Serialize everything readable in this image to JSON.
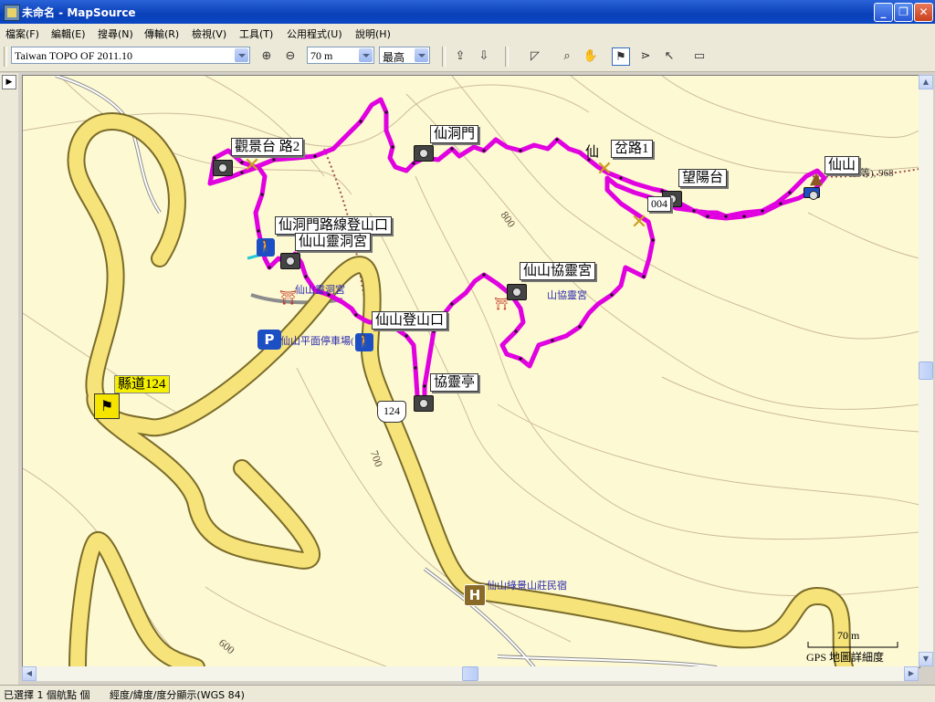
{
  "window": {
    "title": "未命名 - MapSource",
    "buttons": {
      "minimize": "_",
      "maximize": "❐",
      "close": "✕"
    }
  },
  "menu": [
    "檔案(F)",
    "編輯(E)",
    "搜尋(N)",
    "傳輸(R)",
    "檢視(V)",
    "工具(T)",
    "公用程式(U)",
    "說明(H)"
  ],
  "toolbar": {
    "map_product": "Taiwan TOPO OF 2011.10",
    "zoom_level": "70 m",
    "detail_level": "最高"
  },
  "map": {
    "labels": {
      "guanjingtai": "觀景台",
      "guanjingtai_suffix": "路2",
      "xiandongmen": "仙洞門",
      "chalu1": "岔路1",
      "chalu1_prefix": "仙",
      "xianshan": "仙山",
      "xianshan_detail": "三等), 968",
      "wangyangtai": "望陽台",
      "wangyangtai_id": "004",
      "xiandongmen_trailhead": "仙洞門路線登山口",
      "lingdong_temple": "仙山靈洞宮",
      "xiexia_temple": "仙山協靈宮",
      "xianshan_trailhead": "仙山登山口",
      "xielingting": "協靈亭",
      "county_road": "縣道124"
    },
    "poi": {
      "lingdong": "仙山靈洞宮",
      "parking": "仙山平面停車場(",
      "xiexia": "山協靈宮",
      "lodge": "仙山綠景山莊民宿"
    },
    "contours": {
      "c800": "800",
      "c700": "700",
      "c600": "600"
    },
    "road_shield": "124",
    "scale": {
      "distance": "70 m",
      "detail_note": "GPS 地圖詳細度"
    },
    "colors": {
      "track": "#e000e0",
      "road_fill": "#f6e37a",
      "road_casing": "#7a6b2a",
      "background": "#fdf9d2",
      "contour": "#c9b9a0"
    }
  },
  "statusbar": {
    "selection": "已選擇 1 個航點 個",
    "coords": "經度/緯度/度分顯示(WGS 84)"
  }
}
